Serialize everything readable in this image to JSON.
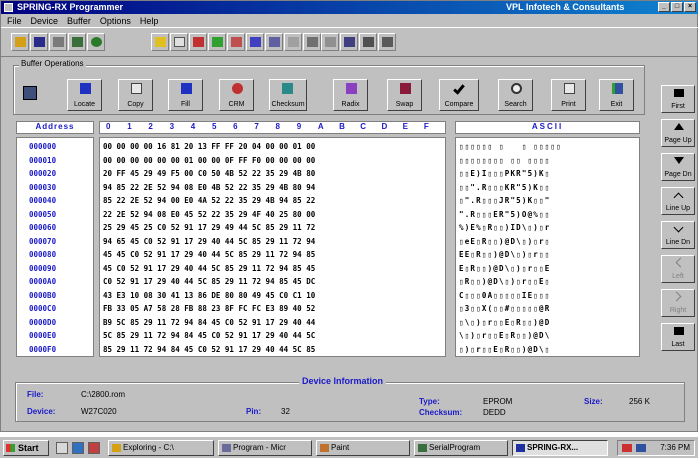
{
  "window": {
    "title": "SPRING-RX Programmer",
    "company": "VPL Infotech & Consultants"
  },
  "menu": [
    "File",
    "Device",
    "Buffer",
    "Options",
    "Help"
  ],
  "operations": {
    "group_label": "Buffer Operations",
    "buttons": [
      "Locate",
      "Copy",
      "Fill",
      "CRM",
      "Checksum",
      "Radix",
      "Swap",
      "Compare",
      "Search",
      "Print",
      "Exit"
    ]
  },
  "nav_buttons": [
    "First",
    "Page Up",
    "Page Dn",
    "Line Up",
    "Line Dn",
    "Left",
    "Right",
    "Last"
  ],
  "grid": {
    "address_header": "Address",
    "hex_header": [
      "0",
      "1",
      "2",
      "3",
      "4",
      "5",
      "6",
      "7",
      "8",
      "9",
      "A",
      "B",
      "C",
      "D",
      "E",
      "F"
    ],
    "ascii_header": "ASCII",
    "addresses": [
      "000000",
      "000010",
      "000020",
      "000030",
      "000040",
      "000050",
      "000060",
      "000070",
      "000080",
      "000090",
      "0000A0",
      "0000B0",
      "0000C0",
      "0000D0",
      "0000E0",
      "0000F0"
    ],
    "hex_rows": [
      "00 00 00 00 16 81 20 13 FF FF 20 04 00 00 01 00",
      "00 00 00 00 00 00 01 00 00 0F FF F0 00 00 00 00",
      "20 FF 45 29 49 F5 00 C0 50 4B 52 22 35 29 4B 80",
      "94 85 22 2E 52 94 08 E0 4B 52 22 35 29 4B 80 94",
      "85 22 2E 52 94 00 E0 4A 52 22 35 29 4B 94 85 22",
      "22 2E 52 94 08 E0 45 52 22 35 29 4F 40 25 80 00",
      "25 29 45 25 C0 52 91 17 29 49 44 5C 85 29 11 72",
      "94 65 45 C0 52 91 17 29 40 44 5C 85 29 11 72 94",
      "45 45 C0 52 91 17 29 40 44 5C 85 29 11 72 94 85",
      "45 C0 52 91 17 29 40 44 5C 85 29 11 72 94 85 45",
      "C0 52 91 17 29 40 44 5C 85 29 11 72 94 85 45 DC",
      "43 E3 10 08 30 41 13 86 DE 80 80 49 45 C0 C1 10",
      "FB 33 05 A7 58 28 FB 88 23 8F FC FC E3 89 40 52",
      "B9 5C 85 29 11 72 94 84 45 C0 52 91 17 29 40 44",
      "5C 85 29 11 72 94 84 45 C0 52 91 17 29 40 44 5C",
      "85 29 11 72 94 84 45 C0 52 91 17 29 40 44 5C 85"
    ],
    "ascii_rows": [
      "▯▯▯▯▯▯ ▯   ▯ ▯▯▯▯▯",
      "▯▯▯▯▯▯▯▯ ▯▯ ▯▯▯▯",
      "▯▯E)I▯▯▯PKR\"5)K▯",
      "▯▯\".R▯▯▯KR\"5)K▯▯",
      "▯\".R▯▯▯JR\"5)K▯▯\"",
      "\".R▯▯▯ER\"5)O@%▯▯",
      "%)E%▯R▯▯)ID\\▯)▯r",
      "▯eE▯R▯▯)@D\\▯)▯r▯",
      "EE▯R▯▯)@D\\▯)▯r▯▯",
      "E▯R▯▯)@D\\▯)▯r▯▯E",
      "▯R▯▯)@D\\▯)▯r▯▯E▯",
      "C▯▯▯0A▯▯▯▯▯IE▯▯▯",
      "▯3▯▯X(▯▯#▯▯▯▯▯@R",
      "▯\\▯)▯r▯▯E▯R▯▯)@D",
      "\\▯)▯r▯▯E▯R▯▯)@D\\",
      "▯)▯r▯▯E▯R▯▯)@D\\▯"
    ]
  },
  "device_info": {
    "title": "Device Information",
    "file_label": "File:",
    "file_value": "C:\\2800.rom",
    "device_label": "Device:",
    "device_value": "W27C020",
    "pin_label": "Pin:",
    "pin_value": "32",
    "type_label": "Type:",
    "type_value": "EPROM",
    "checksum_label": "Checksum:",
    "checksum_value": "DEDD",
    "size_label": "Size:",
    "size_value": "256 K"
  },
  "taskbar": {
    "start": "Start",
    "tasks": [
      "Exploring - C:\\",
      "Program - Micr",
      "Paint",
      "SerialProgram",
      "SPRING-RX..."
    ],
    "clock": "7:36 PM"
  }
}
